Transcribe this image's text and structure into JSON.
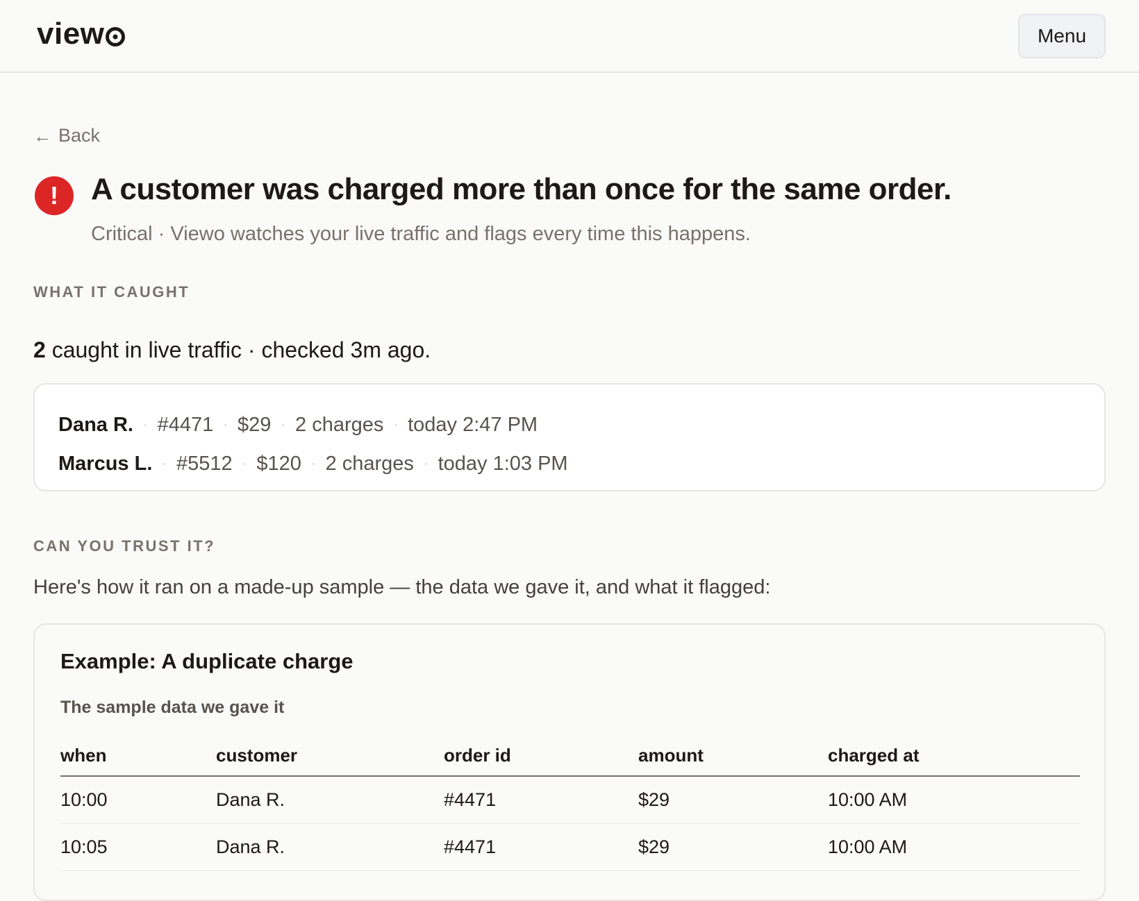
{
  "header": {
    "logo": "view",
    "menu_label": "Menu"
  },
  "nav": {
    "back_label": "Back"
  },
  "alert": {
    "icon_glyph": "!",
    "title": "A customer was charged more than once for the same order.",
    "subtitle": "Critical · Viewo watches your live traffic and flags every time this happens.",
    "color": "#dc2626"
  },
  "caught": {
    "section_label": "What it caught",
    "count": "2",
    "summary_rest": " caught in live traffic · checked 3m ago.",
    "items": [
      {
        "name": "Dana R.",
        "order": "#4471",
        "amount": "$29",
        "charges": "2 charges",
        "time": "today 2:47 PM"
      },
      {
        "name": "Marcus L.",
        "order": "#5512",
        "amount": "$120",
        "charges": "2 charges",
        "time": "today 1:03 PM"
      }
    ]
  },
  "trust": {
    "section_label": "Can you trust it?",
    "description": "Here's how it ran on a made-up sample — the data we gave it, and what it flagged:"
  },
  "example": {
    "title": "Example: A duplicate charge",
    "sample_label": "The sample data we gave it",
    "columns": [
      "when",
      "customer",
      "order id",
      "amount",
      "charged at"
    ],
    "rows": [
      [
        "10:00",
        "Dana R.",
        "#4471",
        "$29",
        "10:00 AM"
      ],
      [
        "10:05",
        "Dana R.",
        "#4471",
        "$29",
        "10:00 AM"
      ]
    ]
  }
}
